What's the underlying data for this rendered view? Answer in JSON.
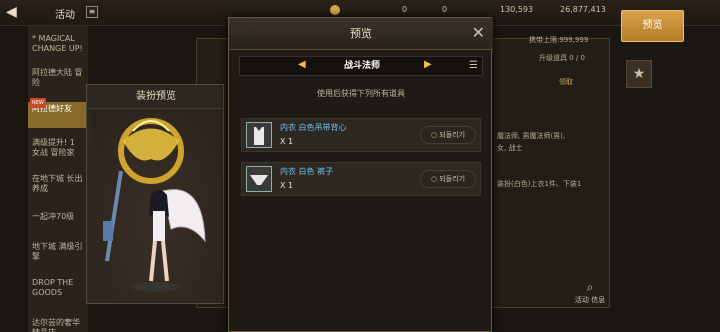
{
  "topbar": {
    "title": "活动",
    "back_icon": "back-arrow-icon",
    "currency1": "0",
    "currency2": "0",
    "currency3": "130,593",
    "currency4": "26,877,413"
  },
  "event_list": {
    "items": [
      "* MAGICAL CHANGE UP!",
      "阿拉德大陆 冒险",
      "阿拉德好友",
      "满级提升! 1 女战 冒险家",
      "在地下城 长出养成",
      "一起冲70级",
      "地下城 满级引擎",
      "DROP THE GOODS",
      "达尔芸的奢华精品店"
    ],
    "new_badge": "NEW"
  },
  "bg_panel": {
    "limit": "携带上限:999,999",
    "text2": "升级道具 0 / 0",
    "text3": "领取",
    "text4": "魔法师, 男魔法师(男),",
    "text5": "女, 战士",
    "text6": "装扮(白色)上衣1件、下装1",
    "search_label": "活动 信息"
  },
  "preview_button": "预览",
  "costume_panel": {
    "title": "装扮预览"
  },
  "modal": {
    "title": "预览",
    "job": "战斗法师",
    "note": "使用后获得下列所有道具",
    "items": [
      {
        "name": "内衣 白色吊带背心",
        "qty": "X 1",
        "button": "되돌리기"
      },
      {
        "name": "内衣 白色 裤子",
        "qty": "X 1",
        "button": "되돌리기"
      }
    ]
  }
}
